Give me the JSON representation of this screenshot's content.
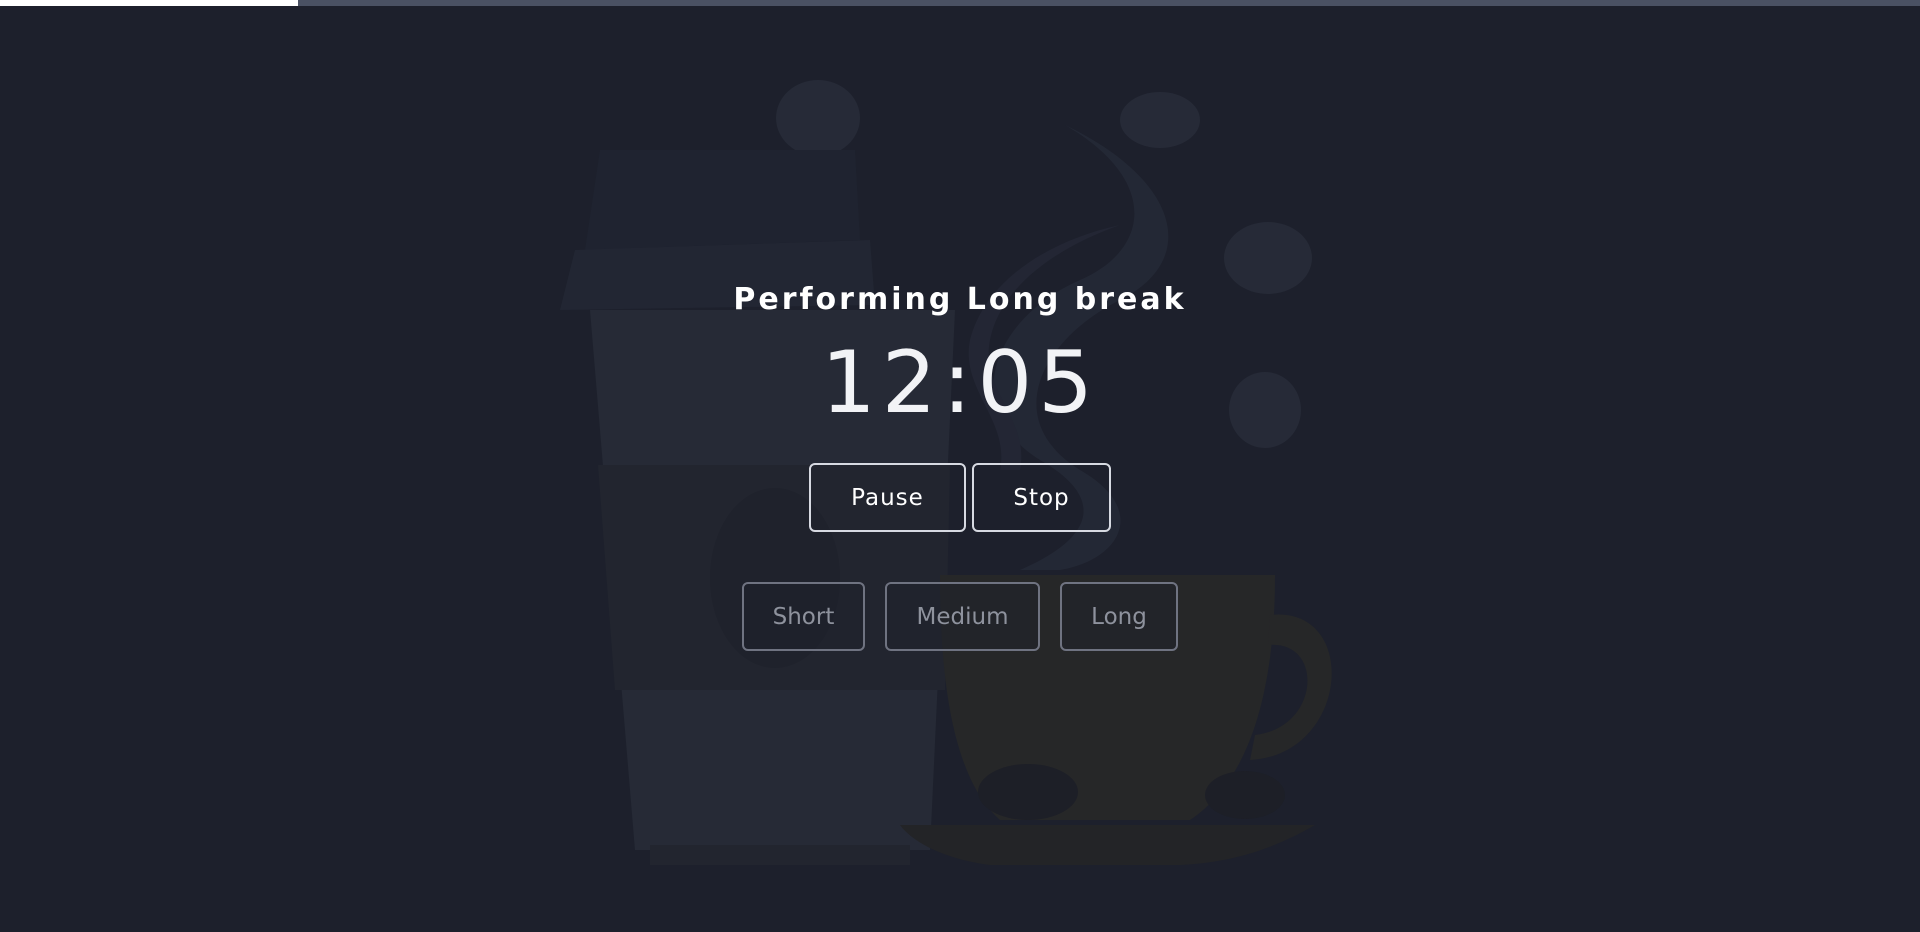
{
  "progress": {
    "fraction": 0.155
  },
  "timer": {
    "status": "Performing Long break",
    "time": "12:05"
  },
  "controls": {
    "pause_label": "Pause",
    "stop_label": "Stop"
  },
  "modes": {
    "short_label": "Short",
    "medium_label": "Medium",
    "long_label": "Long"
  },
  "background": {
    "icon": "coffee-illustration-icon"
  },
  "colors": {
    "background": "#1d202c",
    "progress_track": "#4a5163",
    "progress_fill": "#ffffff",
    "text": "#ffffff"
  }
}
